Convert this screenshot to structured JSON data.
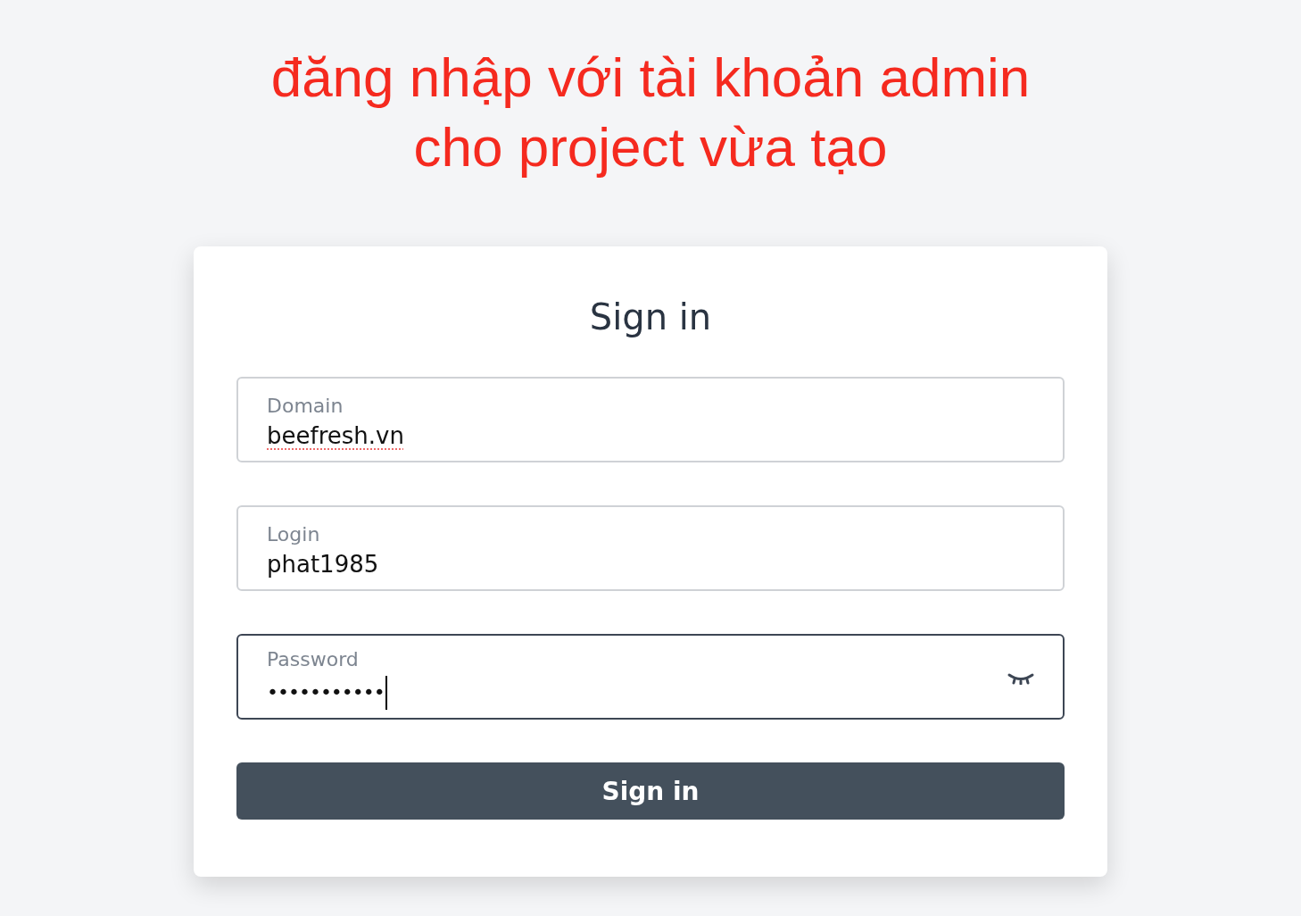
{
  "note": {
    "lines": [
      "đăng nhập với tài khoản admin",
      "cho project vừa tạo"
    ]
  },
  "card": {
    "title": "Sign in",
    "fields": [
      {
        "kind": "text",
        "label": "Domain",
        "value": "beefresh.vn",
        "focused": false,
        "spell_error": true
      },
      {
        "kind": "text",
        "label": "Login",
        "value": "phat1985",
        "focused": false,
        "spell_error": false
      },
      {
        "kind": "password",
        "label": "Password",
        "value": "•••••••••••",
        "focused": true,
        "spell_error": false
      }
    ],
    "button": "Sign in"
  }
}
